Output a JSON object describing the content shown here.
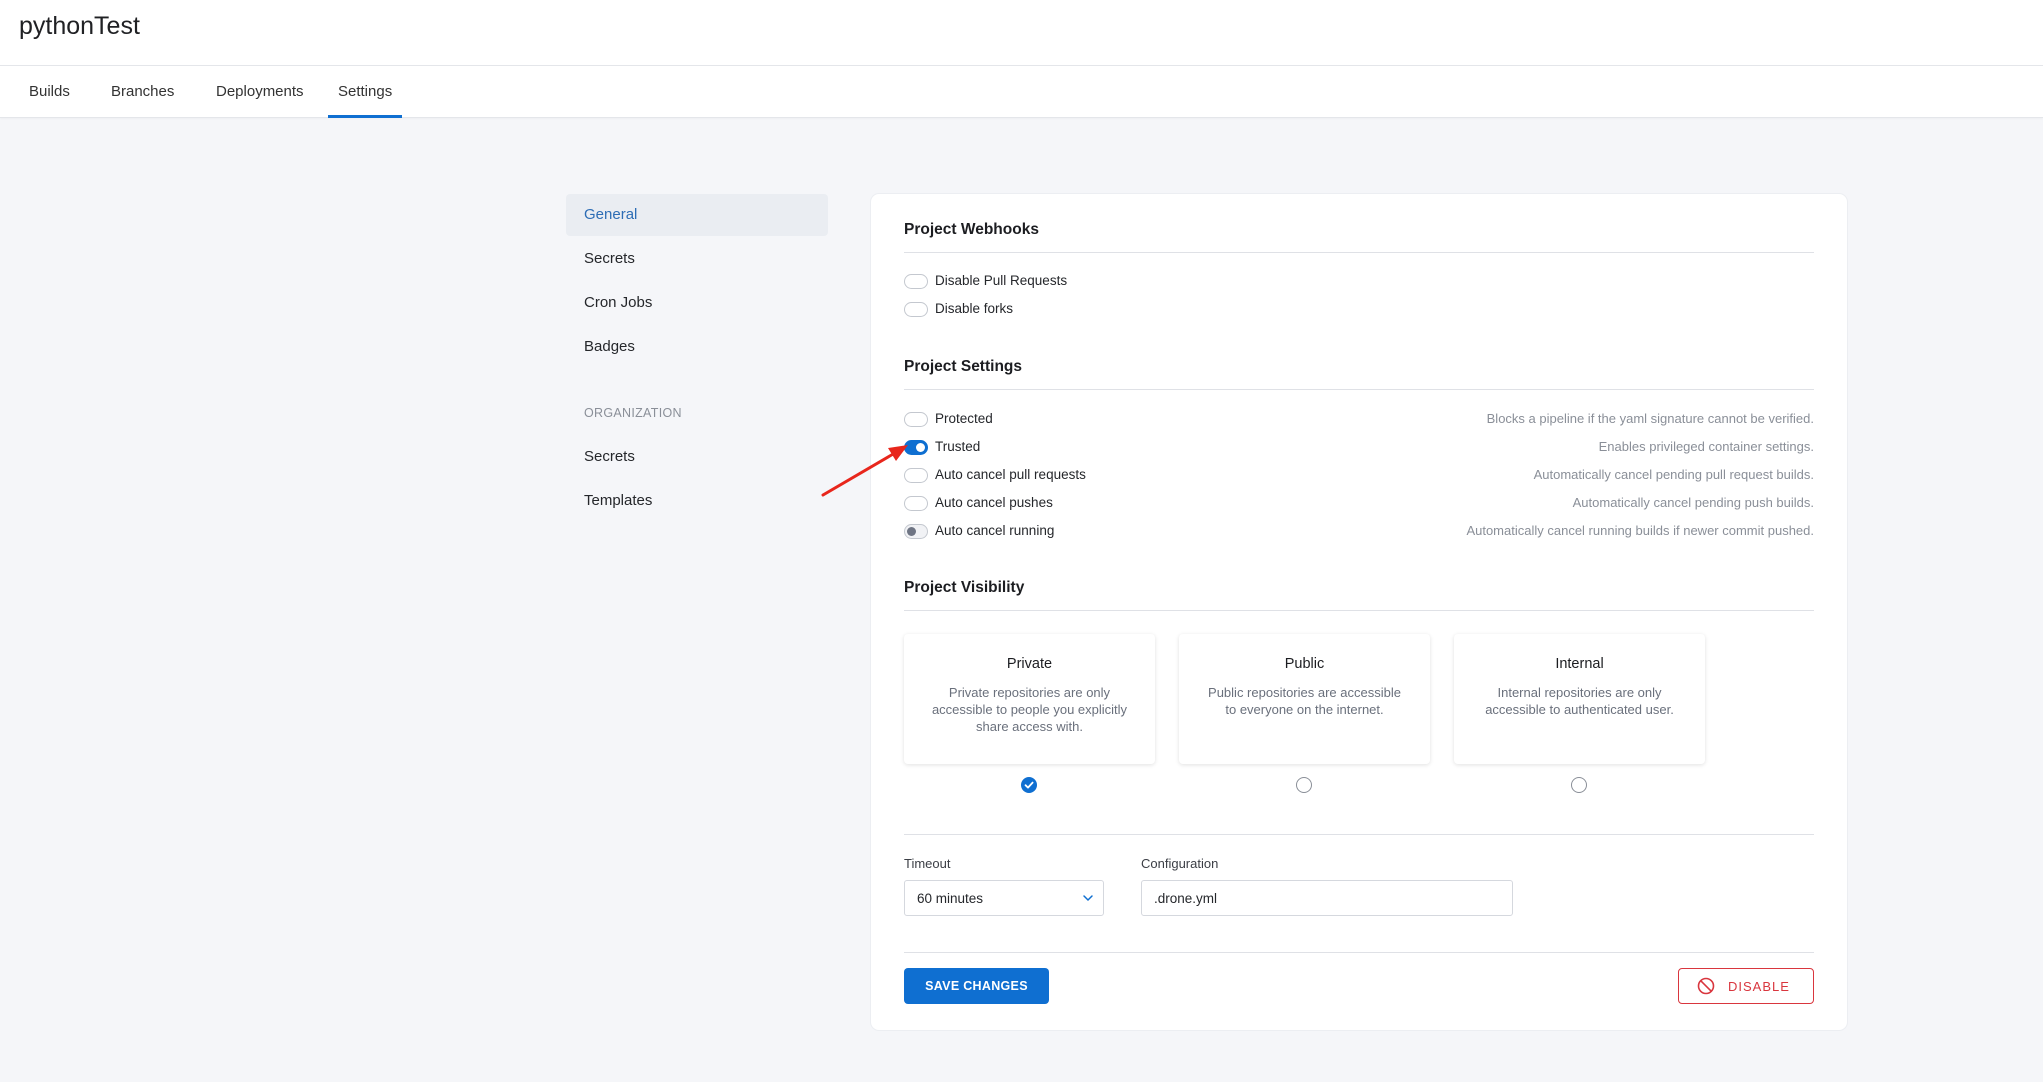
{
  "repo": {
    "title": "pythonTest"
  },
  "tabs": [
    {
      "label": "Builds"
    },
    {
      "label": "Branches"
    },
    {
      "label": "Deployments"
    },
    {
      "label": "Settings",
      "active": true
    }
  ],
  "sidebar": {
    "items": [
      {
        "label": "General",
        "active": true
      },
      {
        "label": "Secrets"
      },
      {
        "label": "Cron Jobs"
      },
      {
        "label": "Badges"
      }
    ],
    "org_section": "ORGANIZATION",
    "org_items": [
      {
        "label": "Secrets"
      },
      {
        "label": "Templates"
      }
    ]
  },
  "webhooks": {
    "title": "Project Webhooks",
    "options": [
      {
        "label": "Disable Pull Requests",
        "enabled": false
      },
      {
        "label": "Disable forks",
        "enabled": false
      }
    ]
  },
  "project_settings": {
    "title": "Project Settings",
    "options": [
      {
        "label": "Protected",
        "desc": "Blocks a pipeline if the yaml signature cannot be verified.",
        "enabled": false
      },
      {
        "label": "Trusted",
        "desc": "Enables privileged container settings.",
        "enabled": true
      },
      {
        "label": "Auto cancel pull requests",
        "desc": "Automatically cancel pending pull request builds.",
        "enabled": false
      },
      {
        "label": "Auto cancel pushes",
        "desc": "Automatically cancel pending push builds.",
        "enabled": false
      },
      {
        "label": "Auto cancel running",
        "desc": "Automatically cancel running builds if newer commit pushed.",
        "enabled": false
      }
    ]
  },
  "visibility": {
    "title": "Project Visibility",
    "selected": "Private",
    "options": [
      {
        "title": "Private",
        "desc": "Private repositories are only accessible to people you explicitly share access with."
      },
      {
        "title": "Public",
        "desc": "Public repositories are accessible to everyone on the internet."
      },
      {
        "title": "Internal",
        "desc": "Internal repositories are only accessible to authenticated user."
      }
    ]
  },
  "timeout": {
    "label": "Timeout",
    "value": "60 minutes"
  },
  "configuration": {
    "label": "Configuration",
    "value": ".drone.yml"
  },
  "actions": {
    "save_label": "SAVE CHANGES",
    "disable_label": "DISABLE"
  },
  "colors": {
    "accent": "#0f6fd1",
    "danger": "#d9363e",
    "annotation": "#e8261c"
  }
}
